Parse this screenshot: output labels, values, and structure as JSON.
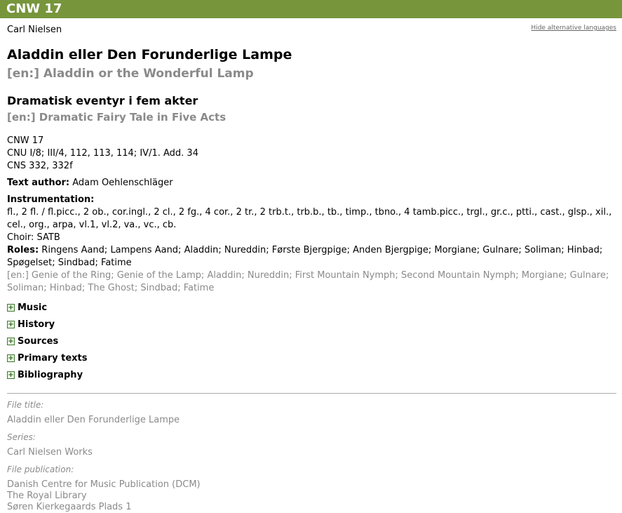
{
  "header": {
    "title": "CNW 17"
  },
  "composer": "Carl Nielsen",
  "hide_alt_link": "Hide alternative languages",
  "title": {
    "main": "Aladdin eller Den Forunderlige Lampe",
    "alt": "[en:] Aladdin or the Wonderful Lamp"
  },
  "subtitle": {
    "main": "Dramatisk eventyr i fem akter",
    "alt": "[en:] Dramatic Fairy Tale in Five Acts"
  },
  "identifiers": [
    "CNW 17",
    "CNU I/8; III/4, 112, 113, 114; IV/1. Add. 34",
    "CNS 332, 332f"
  ],
  "text_author": {
    "label": "Text author:",
    "value": "Adam Oehlenschläger"
  },
  "instrumentation": {
    "label": "Instrumentation:",
    "value": "fl., 2 fl. / fl.picc., 2 ob., cor.ingl., 2 cl., 2 fg., 4 cor., 2 tr., 2 trb.t., trb.b., tb., timp., tbno., 4 tamb.picc., trgl., gr.c., ptti., cast., glsp., xil., cel., org., arpa, vl.1, vl.2, va., vc., cb.",
    "choir": "Choir: SATB"
  },
  "roles": {
    "label": "Roles:",
    "value": "Ringens Aand; Lampens Aand; Aladdin; Nureddin; Første Bjergpige; Anden Bjergpige; Morgiane; Gulnare; Soliman; Hinbad; Spøgelset; Sindbad; Fatime",
    "alt": "[en:] Genie of the Ring; Genie of the Lamp; Aladdin; Nureddin; First Mountain Nymph; Second Mountain Nymph; Morgiane; Gulnare; Soliman; Hinbad; The Ghost; Sindbad; Fatime"
  },
  "sections": [
    "Music",
    "History",
    "Sources",
    "Primary texts",
    "Bibliography"
  ],
  "file_info": {
    "file_title_label": "File title:",
    "file_title": "Aladdin eller Den Forunderlige Lampe",
    "series_label": "Series:",
    "series": "Carl Nielsen Works",
    "publication_label": "File publication:",
    "publication_lines": [
      "Danish Centre for Music Publication (DCM)",
      "The Royal Library",
      "Søren Kierkegaards Plads 1"
    ]
  }
}
